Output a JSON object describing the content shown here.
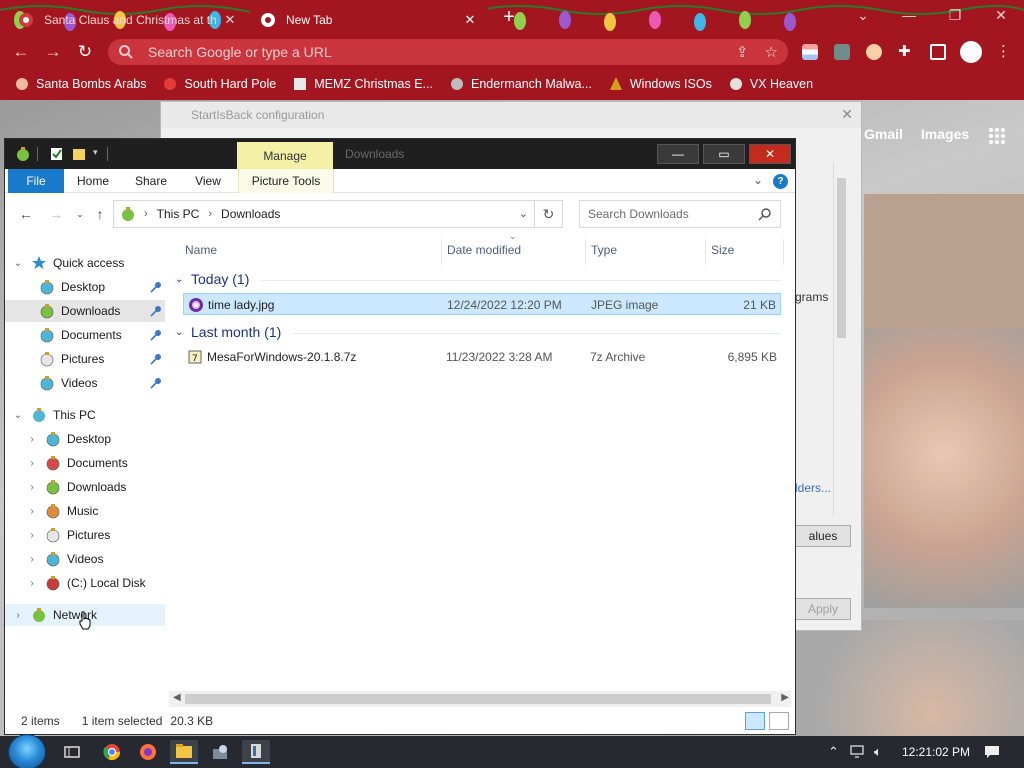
{
  "chrome": {
    "tabs": [
      {
        "label": "Santa Claus and Christmas at th",
        "active": false
      },
      {
        "label": "New Tab",
        "active": true
      }
    ],
    "omnibox_placeholder": "Search Google or type a URL",
    "bookmarks": [
      "Santa Bombs Arabs",
      "South Hard Pole",
      "MEMZ Christmas E...",
      "Endermanch Malwa...",
      "Windows ISOs",
      "VX Heaven"
    ],
    "page_links": [
      "Gmail",
      "Images"
    ],
    "accent_color": "#a4161f"
  },
  "background_dialog": {
    "title": "StartIsBack configuration",
    "partial_text": [
      "grams",
      "lders..."
    ],
    "buttons": [
      "alues",
      "Apply"
    ]
  },
  "explorer": {
    "title": "Downloads",
    "contextual_tab": "Manage",
    "ribbon_tabs": [
      "File",
      "Home",
      "Share",
      "View",
      "Picture Tools"
    ],
    "address": {
      "root": "This PC",
      "current": "Downloads"
    },
    "search_placeholder": "Search Downloads",
    "columns": [
      "Name",
      "Date modified",
      "Type",
      "Size"
    ],
    "groups": [
      {
        "label": "Today (1)",
        "files": [
          {
            "name": "time lady.jpg",
            "date": "12/24/2022 12:20 PM",
            "type": "JPEG image",
            "size": "21 KB",
            "selected": true
          }
        ]
      },
      {
        "label": "Last month (1)",
        "files": [
          {
            "name": "MesaForWindows-20.1.8.7z",
            "date": "11/23/2022 3:28 AM",
            "type": "7z Archive",
            "size": "6,895 KB",
            "selected": false
          }
        ]
      }
    ],
    "nav_pane": {
      "quick_access": {
        "label": "Quick access",
        "items": [
          "Desktop",
          "Downloads",
          "Documents",
          "Pictures",
          "Videos"
        ]
      },
      "this_pc": {
        "label": "This PC",
        "items": [
          "Desktop",
          "Documents",
          "Downloads",
          "Music",
          "Pictures",
          "Videos",
          "(C:) Local Disk"
        ]
      },
      "network": "Network"
    },
    "status": {
      "count": "2 items",
      "selection": "1 item selected",
      "size": "20.3 KB"
    }
  },
  "taskbar": {
    "clock": "12:21:02 PM"
  }
}
